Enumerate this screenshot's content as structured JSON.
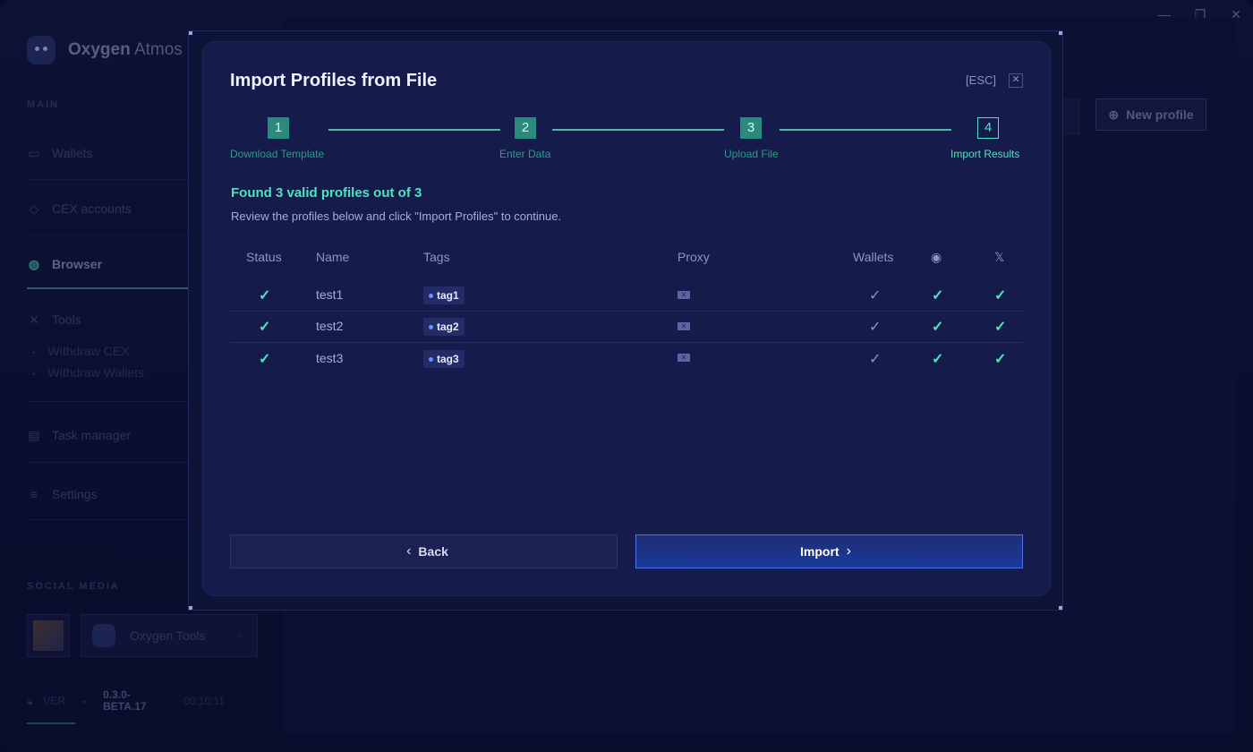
{
  "app": {
    "brand_bold": "Oxygen",
    "brand_light": "Atmos",
    "window_controls": [
      "minimize-icon",
      "restore-icon",
      "close-icon"
    ]
  },
  "sidebar": {
    "main_title": "MAIN",
    "items": {
      "wallets": "Wallets",
      "cex": "CEX accounts",
      "browser": "Browser",
      "tools": "Tools",
      "withdraw_cex": "Withdraw CEX",
      "withdraw_wallets": "Withdraw Wallets",
      "task_manager": "Task manager",
      "settings": "Settings"
    },
    "social_title": "SOCIAL MEDIA",
    "social_card_label": "Oxygen Tools",
    "version_label": "VER",
    "version_value": "0.3.0-BETA.17",
    "version_time": "00:10:11"
  },
  "header": {
    "new_profile_label": "New profile"
  },
  "modal": {
    "title": "Import Profiles from File",
    "esc_label": "[ESC]",
    "steps": [
      {
        "num": "1",
        "label": "Download Template"
      },
      {
        "num": "2",
        "label": "Enter Data"
      },
      {
        "num": "3",
        "label": "Upload File"
      },
      {
        "num": "4",
        "label": "Import Results"
      }
    ],
    "found_text": "Found 3 valid profiles out of 3",
    "review_text": "Review the profiles below and click \"Import Profiles\" to continue.",
    "columns": {
      "status": "Status",
      "name": "Name",
      "tags": "Tags",
      "proxy": "Proxy",
      "wallets": "Wallets"
    },
    "rows": [
      {
        "name": "test1",
        "tag": "tag1"
      },
      {
        "name": "test2",
        "tag": "tag2"
      },
      {
        "name": "test3",
        "tag": "tag3"
      }
    ],
    "back_label": "Back",
    "import_label": "Import",
    "accent_color": "#4fe3bf"
  }
}
